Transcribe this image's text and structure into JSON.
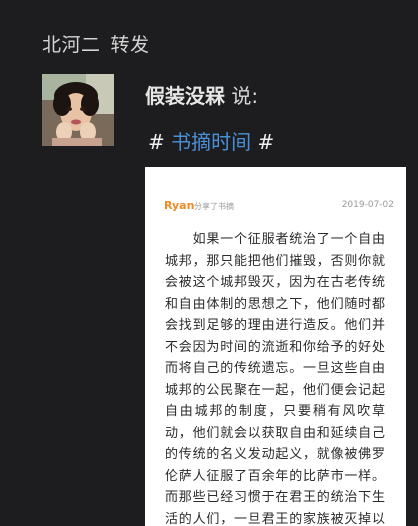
{
  "repost": {
    "user": "北河二",
    "action": "转发"
  },
  "post": {
    "author": "假装没槑",
    "said": "说:",
    "topic_hash_open": "#",
    "topic": "书摘时间",
    "topic_hash_close": "#"
  },
  "card": {
    "user": "Ryan",
    "action": "分享了书摘",
    "date": "2019-07-02",
    "text": "　　如果一个征服者统治了一个自由城邦，那只能把他们摧毁，否则你就会被这个城邦毁灭，因为在古老传统和自由体制的思想之下，他们随时都会找到足够的理由进行造反。他们并不会因为时间的流逝和你给予的好处而将自己的传统遗忘。一旦这些自由城邦的公民聚在一起，他们便会记起自由城邦的制度，只要稍有风吹草动，他们就会以获取自由和延续自己的传统的名义发动起义，就像被佛罗伦萨人征服了百余年的比萨市一样。而那些已经习惯于在君王的统治下生活的人们，一旦君王的家族被灭掉以后，他们就没有了反抗"
  }
}
